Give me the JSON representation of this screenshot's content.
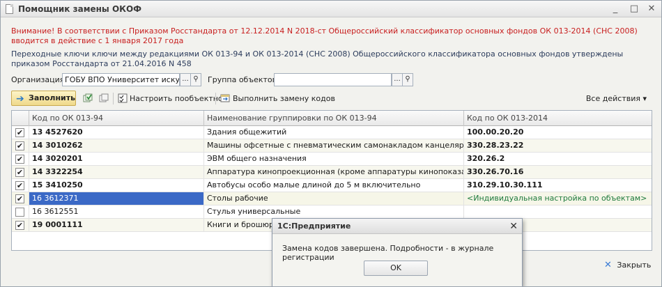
{
  "window": {
    "title": "Помощник замены ОКОФ",
    "minimize_glyph": "_",
    "maximize_glyph": "□",
    "close_glyph": "✕"
  },
  "notices": {
    "warning": "Внимание! В соответствии с Приказом Росстандарта от 12.12.2014 N 2018-ст  Общероссийский классификатор основных фондов ОК 013-2014 (СНС 2008) вводится в действие с 1 января 2017 года",
    "info": "Переходные ключи ключи между редакциями ОК 013-94 и ОК 013-2014 (СНС 2008) Общероссийского классификатора основных фондов утверждены приказом Росстандарта от 21.04.2016 N 458"
  },
  "filters": {
    "organization_label": "Организация:",
    "organization_value": "ГОБУ ВПО Университет искусст",
    "group_label": "Группа объектов:",
    "group_value": "",
    "ellipsis": "...",
    "search_glyph": "⚲"
  },
  "toolbar": {
    "fill_label": "Заполнить",
    "configure_label": "Настроить пообъектно",
    "replace_label": "Выполнить замену кодов",
    "all_actions_label": "Все действия ▾"
  },
  "table": {
    "columns": [
      "Код по ОК 013-94",
      "Наименование группировки по ОК 013-94",
      "Код по ОК 013-2014"
    ],
    "rows": [
      {
        "checked": true,
        "code_old": "13 4527620",
        "name": "Здания общежитий",
        "code_new": "100.00.20.20"
      },
      {
        "checked": true,
        "code_old": "14 3010262",
        "name": "Машины офсетные с пневматическим самонакладом канцелярские",
        "code_new": "330.28.23.22"
      },
      {
        "checked": true,
        "code_old": "14 3020201",
        "name": "ЭВМ общего назначения",
        "code_new": "320.26.2"
      },
      {
        "checked": true,
        "code_old": "14 3322254",
        "name": "Аппаратура кинопроекционная (кроме аппаратуры кинопоказа)",
        "code_new": "330.26.70.16"
      },
      {
        "checked": true,
        "code_old": "15 3410250",
        "name": "Автобусы особо малые длиной до 5 м включительно",
        "code_new": "310.29.10.30.111"
      },
      {
        "checked": true,
        "code_old": "16 3612371",
        "name": "Столы рабочие",
        "code_new": "<Индивидуальная настройка по объектам>"
      },
      {
        "checked": false,
        "code_old": "16 3612551",
        "name": "Стулья универсальные",
        "code_new": ""
      },
      {
        "checked": true,
        "code_old": "19 0001111",
        "name": "Книги и брошюры",
        "code_new": ""
      }
    ]
  },
  "footer": {
    "close_label": "Закрыть",
    "close_glyph": "✕"
  },
  "dialog": {
    "title": "1С:Предприятие",
    "message": "Замена кодов завершена. Подробности - в журнале регистрации",
    "ok_label": "OK",
    "close_glyph": "✕"
  },
  "colors": {
    "warning_text": "#c81e1e",
    "active_cell": "#3b69c6",
    "individual_setting_text": "#1e7a3c",
    "fill_button": "#efd98a"
  }
}
